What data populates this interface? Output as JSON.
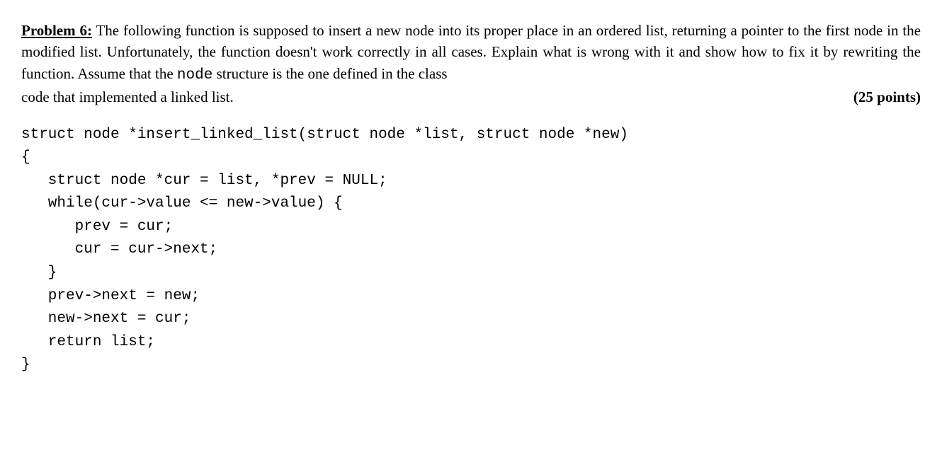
{
  "problem": {
    "label": "Problem 6:",
    "text_part1": " The following function is supposed to insert a new node into its proper place in an ordered list, returning a pointer to the first node in the modified list. Unfortunately, the function doesn't work correctly in all cases. Explain what is wrong with it and show how to fix it by rewriting the function. Assume that the ",
    "code_word": "node",
    "text_part2": " structure is the one defined in the class ",
    "last_line_text": "code that implemented a linked list.",
    "points": "(25 points)"
  },
  "code": "struct node *insert_linked_list(struct node *list, struct node *new)\n{\n   struct node *cur = list, *prev = NULL;\n   while(cur->value <= new->value) {\n      prev = cur;\n      cur = cur->next;\n   }\n   prev->next = new;\n   new->next = cur;\n   return list;\n}"
}
